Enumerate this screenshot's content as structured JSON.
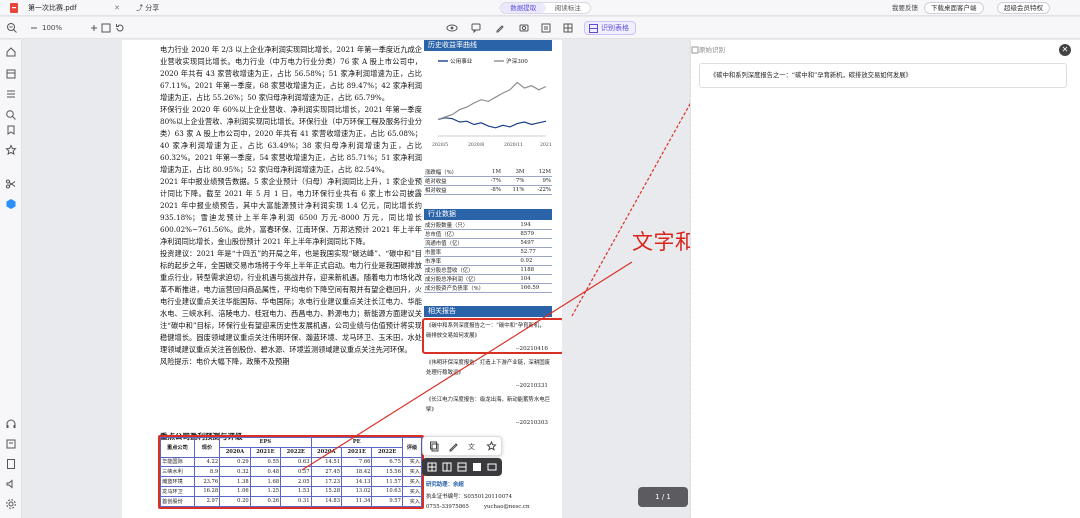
{
  "tabs": {
    "file_name": "第一次比赛.pdf",
    "share": "分享"
  },
  "mode": {
    "options": [
      "数据提取",
      "阅读标注"
    ],
    "active": 0
  },
  "top_right": {
    "login": "我要反馈",
    "download": "下载桌面客户端",
    "member": "超级会员特权"
  },
  "toolbar": {
    "zoom": "100%",
    "recognize_label": "识别表格"
  },
  "doc": {
    "para1": "电力行业 2020 年 2/3 以上企业净利润实现同比增长，2021 年第一季度近九成企业营收实现同比增长。电力行业（中万电力行业分类）76 家 A 股上市公司中，2020 年共有 43 家营收增速为正，占比 56.58%；51 家净利润增速为正，占比 67.11%。2021 年第一季度，68 家营收增速为正，占比 89.47%；42 家净利润增速为正，占比 55.26%；50 家归母净利润增速为正，占比 65.79%。",
    "para2": "环保行业 2020 年 60%以上企业营收、净利润实现同比增长，2021 年第一季度 80%以上企业营收、净利润实现同比增长。环保行业（中万环保工程及服务行业分类）63 家 A 股上市公司中，2020 年共有 41 家营收增速为正，占比 65.08%；40 家净利润增速为正，占比 63.49%；38 家归母净利润增速为正，占比 60.32%。2021 年第一季度，54 家营收增速为正，占比 85.71%；51 家净利润增速为正，占比 80.95%；52 家归母净利润增速为正，占比 82.54%。",
    "para3": "2021 年中报业绩预告数据。5 家企业预计（归母）净利润同比上升，1 家企业预计同比下降。截至 2021 年 5 月 1 日，电力环保行业共有 6 家上市公司披露 2021 年中报业绩预告，其中大富能源预计净利润实现 1.4 亿元，同比增长约 935.18%；雪迪龙预计上半年净利润 6500 万元-8000 万元，同比增长 600.02%~761.56%。此外，富春环保、江南环保、万邦达预计 2021 年上半年净利润同比增长，金山股份预计 2021 年上半年净利润同比下降。",
    "para4": "投资建议：2021 年是“十四五”的开局之年，也是我国实现“碳达峰”、“碳中和”目标的起步之年，全国碳交易市场将于今年上半年正式启动。电力行业是我国碳排放重点行业，转型需求迫切，行业机遇与挑战并存，迎来新机遇。随着电力市场化改革不断推进，电力运营回归商品属性，平均电价下降空间有限并有望企稳回升，火电行业建议重点关注华能国际、华电国际；水电行业建议重点关注长江电力、华能水电、三峡水利、涪陵电力、桂冠电力、西昌电力、黔源电力；新能源方面建议关注“碳中和”目标，环保行业有望迎来历史性发展机遇，公司业绩与估值预计将实现稳健增长。固废领域建议重点关注伟明环保、瀚蓝环境、龙马环卫、玉禾田，水处理领域建议重点关注首创股份、碧水源、环境监测领域建议重点关注先河环保。",
    "para5": "风险提示：电价大幅下降，政策不及预期",
    "fin_title": "重点公司盈利预测与评级",
    "fin_headers": {
      "company": "重点公司",
      "price": "现价",
      "eps": "EPS",
      "pe": "PE",
      "rating": "评级"
    },
    "fin_years": [
      "2020A",
      "2021E",
      "2022E",
      "2020A",
      "2021E",
      "2022E"
    ],
    "fin_rows": [
      [
        "华能国际",
        "4.22",
        "0.29",
        "0.55",
        "0.63",
        "14.51",
        "7.66",
        "6.75",
        "买入"
      ],
      [
        "三峡水利",
        "8.9",
        "0.32",
        "0.48",
        "0.57",
        "27.45",
        "18.42",
        "15.56",
        "买入"
      ],
      [
        "瀚蓝环境",
        "23.76",
        "1.38",
        "1.68",
        "2.05",
        "17.23",
        "14.13",
        "11.57",
        "买入"
      ],
      [
        "龙马环卫",
        "16.28",
        "1.06",
        "1.25",
        "1.53",
        "15.28",
        "13.02",
        "10.63",
        "买入"
      ],
      [
        "首创股份",
        "2.97",
        "0.20",
        "0.26",
        "0.31",
        "14.83",
        "11.34",
        "9.57",
        "买入"
      ]
    ]
  },
  "sidebar": {
    "chart_head": "历史收益率曲线",
    "legend_a": "公用事业",
    "legend_b": "沪深300",
    "ret_headers": [
      "涨跌幅（%）",
      "1M",
      "3M",
      "12M"
    ],
    "ret_rows": [
      [
        "绝对收益",
        "-7%",
        "7%",
        "9%"
      ],
      [
        "相对收益",
        "-8%",
        "11%",
        "-22%"
      ]
    ],
    "ind_head": "行业数据",
    "ind_rows": [
      [
        "成分股数量（只）",
        "194"
      ],
      [
        "总市值（亿）",
        "8579"
      ],
      [
        "流通市值（亿）",
        "5497"
      ],
      [
        "市盈率",
        "52.77"
      ],
      [
        "市净率",
        "0.92"
      ],
      [
        "成分股总营收（亿）",
        "1188"
      ],
      [
        "成分股总净利润（亿）",
        "104"
      ],
      [
        "成分股资产负债率（%）",
        "166.59"
      ]
    ],
    "rel_head": "相关报告",
    "rel1": "《碳中和系列深度报告之一：“碳中和”孕育新机，碳排放交易如何发展》",
    "rel1_date": "--20210416",
    "rel2": "《伟明环保深度报告：打造上下游产业链，深耕固废处理行稳致远》",
    "rel2_date": "--20210331",
    "rel3": "《长江电力深度报告：级龙出海，新动能蓄势水电巨擘》",
    "rel3_date": "--20210303",
    "analyst": "研究助理：余超",
    "license": "执业证书编号：S0550120110074",
    "phone": "0755-33975865",
    "email": "yuchao@nesc.cn"
  },
  "chart_data": {
    "type": "line",
    "title": "",
    "x": [
      "2020/5",
      "2020/8",
      "2020/11",
      "2021/2"
    ],
    "series": [
      {
        "name": "公用事业",
        "values": [
          0,
          2,
          1,
          -3,
          -2,
          -6,
          -4,
          -8,
          -10,
          -7,
          -9,
          -5,
          -3,
          -6,
          -4,
          -2
        ]
      },
      {
        "name": "沪深300",
        "values": [
          0,
          3,
          6,
          12,
          15,
          20,
          24,
          22,
          27,
          32,
          36,
          45,
          38,
          41,
          36,
          40
        ]
      }
    ],
    "ylim": [
      -20,
      60
    ],
    "colors": [
      "#1a3f8f",
      "#8e8e8e"
    ]
  },
  "annotation": "文字和表格的识别都准确且完整",
  "panel": {
    "title": "原始识别",
    "recognized_text": "《碳中和系列深度报告之一：“碳中和”孕育新机，碳排放交易如何发展》"
  },
  "page_indicator": "1  /  1",
  "colors": {
    "accent": "#5b4fd9",
    "highlight": "#d93025",
    "section": "#2b63a8"
  }
}
